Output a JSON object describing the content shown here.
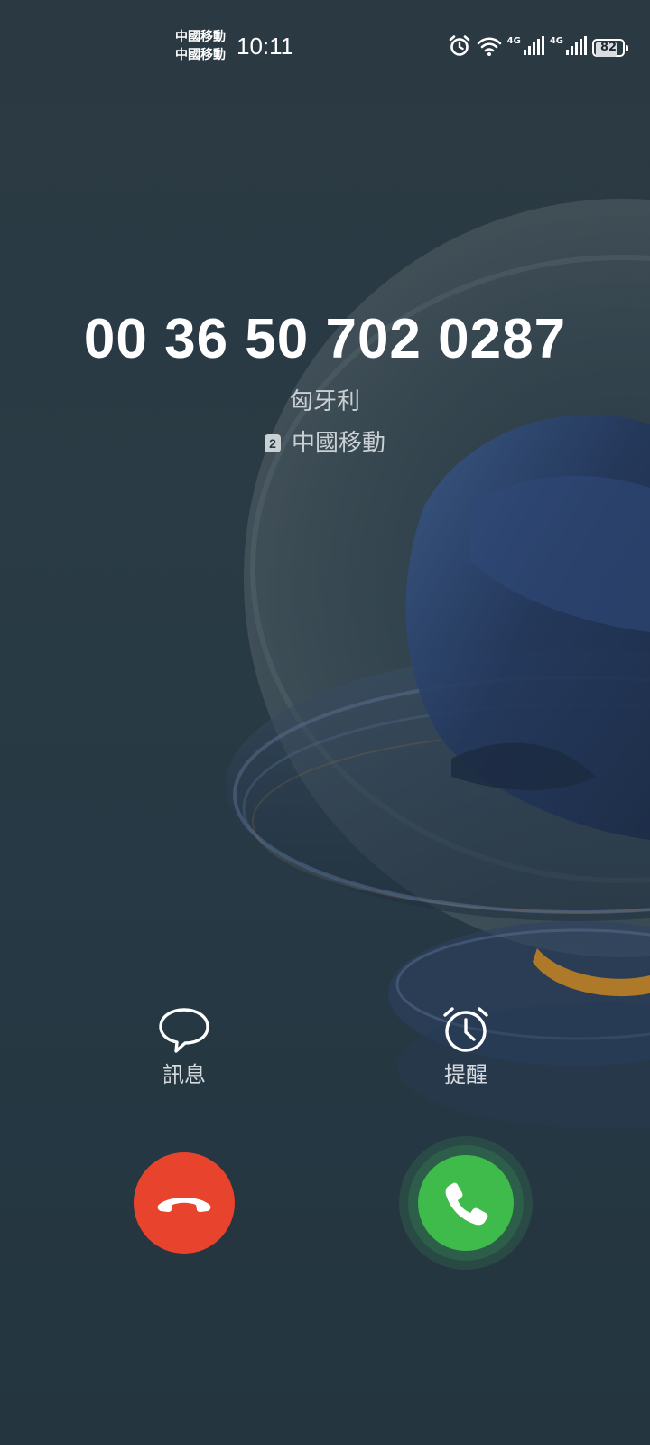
{
  "status_bar": {
    "carriers": [
      "中國移動",
      "中國移動"
    ],
    "time": "10:11",
    "network_types": [
      "4G",
      "4G"
    ],
    "battery_level": "82",
    "battery_fraction": 0.82,
    "icons": [
      "alarm-icon",
      "wifi-icon",
      "signal-icon-sim1",
      "signal-icon-sim2",
      "battery-icon"
    ]
  },
  "caller": {
    "number": "00 36 50 702 0287",
    "location": "匈牙利",
    "sim_slot": "2",
    "sim_carrier": "中國移動"
  },
  "quick_actions": {
    "message": {
      "label": "訊息",
      "icon": "chat-bubble-icon"
    },
    "remind": {
      "label": "提醒",
      "icon": "alarm-clock-icon"
    }
  },
  "call_buttons": {
    "decline": {
      "icon": "hang-up-icon",
      "color": "#e8432c"
    },
    "answer": {
      "icon": "phone-icon",
      "color": "#3ebb4a"
    }
  }
}
